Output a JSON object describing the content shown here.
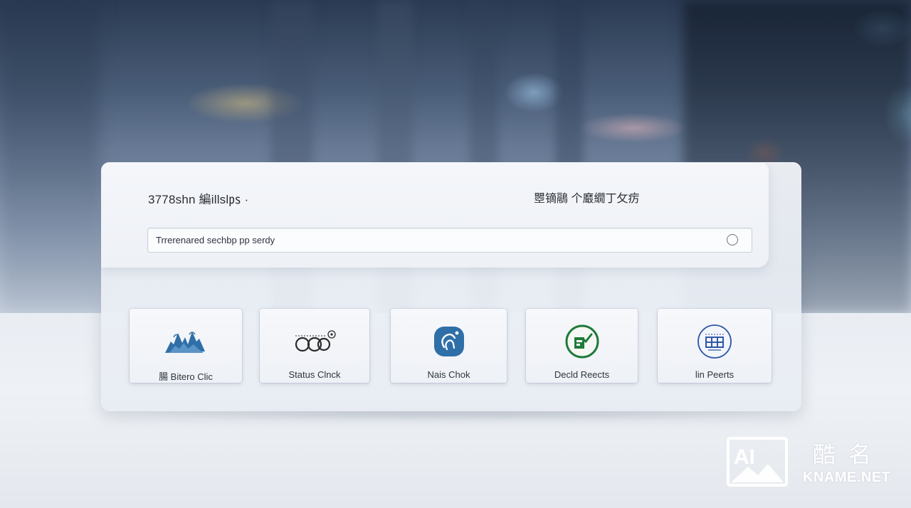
{
  "header": {
    "title_left": "3778shn 編illsl㎰ ·",
    "title_right": "瞾镝鷊 个黀繝丁攵疠"
  },
  "search": {
    "value": "Trrerenared sechbp pp serdy"
  },
  "cards": [
    {
      "label": "腸 Bitero Clic",
      "icon": "mountain-splash-icon"
    },
    {
      "label": "Status Clnck",
      "icon": "glasses-icon"
    },
    {
      "label": "Nais Chok",
      "icon": "touch-app-icon"
    },
    {
      "label": "Decld Reects",
      "icon": "document-check-icon"
    },
    {
      "label": "lin Peerts",
      "icon": "server-rack-icon"
    }
  ],
  "watermark": {
    "logo_text": "AI",
    "cn_text": "酷名",
    "en_text": "KNAME.NET"
  },
  "colors": {
    "accent_blue": "#2f6fa8",
    "accent_green": "#1f7a3a",
    "panel_bg": "#f2f4f8"
  }
}
